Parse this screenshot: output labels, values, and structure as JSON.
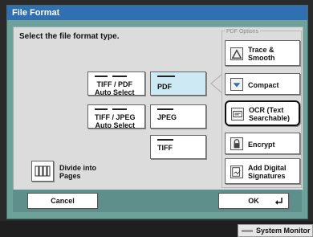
{
  "window": {
    "title": "File Format"
  },
  "prompt": "Select the file format type.",
  "formats": {
    "tiff_pdf_auto": {
      "line1": "TIFF  / PDF",
      "line2": "Auto Select"
    },
    "pdf": {
      "label": "PDF"
    },
    "tiff_jpeg_auto": {
      "line1": "TIFF  / JPEG",
      "line2": "Auto Select"
    },
    "jpeg": {
      "label": "JPEG"
    },
    "tiff": {
      "label": "TIFF"
    }
  },
  "divide": {
    "line1": "Divide into",
    "line2": "Pages"
  },
  "pdf_options": {
    "title": "PDF Options",
    "trace_smooth": {
      "line1": "Trace &",
      "line2": "Smooth"
    },
    "compact": {
      "label": "Compact"
    },
    "ocr": {
      "line1": "OCR (Text",
      "line2": "Searchable)"
    },
    "encrypt": {
      "label": "Encrypt"
    },
    "digital_signatures": {
      "line1": "Add Digital",
      "line2": "Signatures"
    }
  },
  "bottom": {
    "cancel_label": "Cancel",
    "ok_label": "OK"
  },
  "system_monitor": {
    "label": "System Monitor"
  },
  "colors": {
    "titlebar": "#2f6fb2",
    "window_bg": "#6fa19b",
    "selected": "#cde9f4"
  }
}
